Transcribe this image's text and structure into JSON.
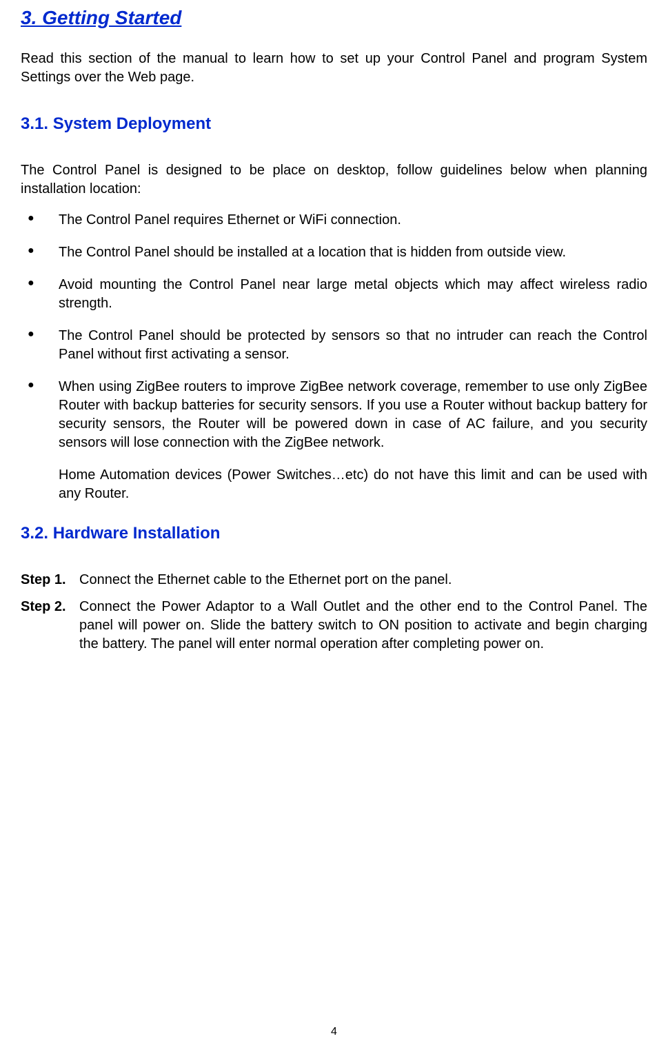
{
  "heading_main": "3.  Getting Started",
  "intro": "Read this section of the manual to learn how to set up your Control Panel and program System Settings over the Web page.",
  "heading_31": "3.1. System Deployment",
  "body_31": "The Control Panel is designed to be place on desktop, follow guidelines below when planning installation location:",
  "bullets": [
    "The Control Panel requires Ethernet or WiFi connection.",
    "The Control Panel should be installed at a location that is hidden from outside view.",
    "Avoid mounting the Control Panel near large metal objects which may affect wireless radio strength.",
    "The Control Panel should be protected by sensors so that no intruder can reach the Control Panel without first activating a sensor.",
    "When using ZigBee routers to improve ZigBee network coverage, remember to use only ZigBee Router with backup batteries for security sensors. If you use a Router without backup battery for security sensors, the Router will be powered down in case of AC failure, and you security sensors will lose connection with the ZigBee network."
  ],
  "bullet_sub": "Home Automation devices (Power Switches…etc) do not have this limit and can be used with any Router.",
  "heading_32": "3.2. Hardware Installation",
  "steps": [
    {
      "label": "Step 1.",
      "text": "Connect the Ethernet cable to the Ethernet port on the panel."
    },
    {
      "label": "Step 2.",
      "text": "Connect the Power Adaptor to a Wall Outlet and the other end to the Control Panel. The panel will power on. Slide the battery switch to ON position to activate and begin charging the battery. The panel will enter normal operation after completing power on."
    }
  ],
  "page_number": "4"
}
